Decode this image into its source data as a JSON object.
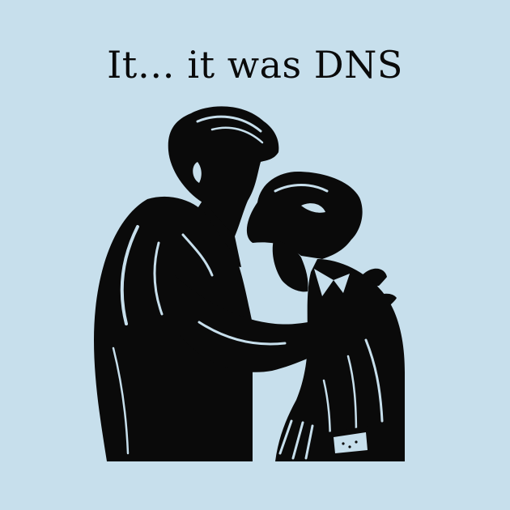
{
  "caption": {
    "text": "It… it was DNS"
  },
  "illustration": {
    "subject": "man-consoling-woman-silhouette",
    "ink_color": "#0a0a0a",
    "background_color": "#c7dfec"
  }
}
